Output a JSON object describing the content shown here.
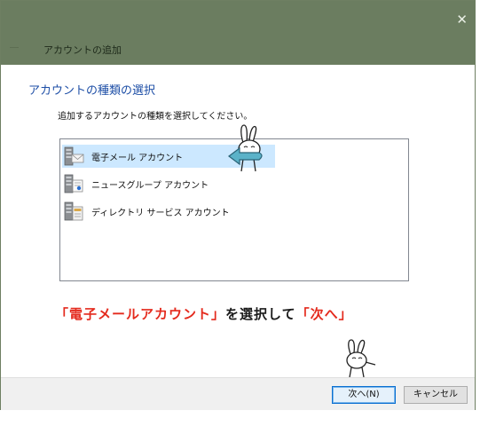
{
  "window": {
    "title": "アカウントの追加",
    "close_glyph": "✕"
  },
  "page": {
    "heading": "アカウントの種類の選択",
    "instruction": "追加するアカウントの種類を選択してください。"
  },
  "account_types": [
    {
      "label": "電子メール アカウント",
      "icon": "email-server-icon",
      "selected": true
    },
    {
      "label": "ニュースグループ アカウント",
      "icon": "newsgroup-server-icon",
      "selected": false
    },
    {
      "label": "ディレクトリ サービス アカウント",
      "icon": "directory-server-icon",
      "selected": false
    }
  ],
  "annotation": {
    "part1": "「電子メールアカウント」",
    "part2": "を選択して",
    "part3": "「次へ」"
  },
  "buttons": {
    "next": "次へ(N)",
    "cancel": "キャンセル"
  },
  "colors": {
    "titlebar": "#6b7d60",
    "heading": "#1d4ea6",
    "selection": "#cce8ff",
    "annotation_red": "#e42a1d",
    "pointer_arrow": "#5bb2c8"
  }
}
